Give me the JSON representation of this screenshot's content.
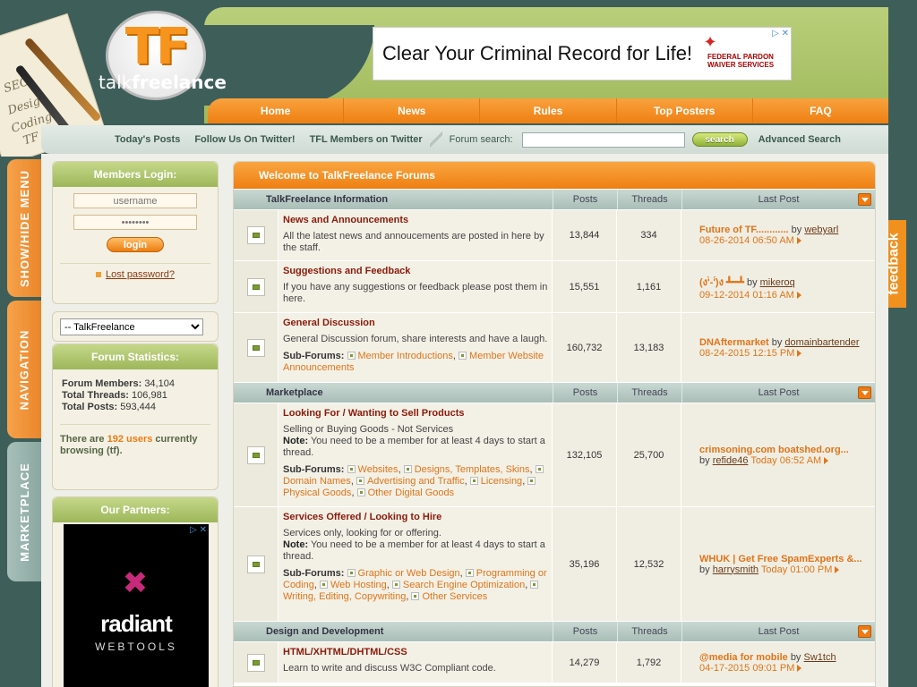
{
  "logo": {
    "letters": "TF",
    "name_part1": "talk",
    "name_part2": "freelance"
  },
  "artwork": {
    "words": [
      "SEO",
      "Design",
      "Coding",
      "TF"
    ]
  },
  "ad_top": {
    "headline": "Clear Your Criminal Record for Life!",
    "brand_line1": "FEDERAL PARDON",
    "brand_line2": "WAIVER SERVICES",
    "controls": "▷ ✕"
  },
  "main_nav": [
    "Home",
    "News",
    "Rules",
    "Top Posters",
    "FAQ"
  ],
  "sub_nav": {
    "links": [
      "Today's Posts",
      "Follow Us On Twitter!",
      "TFL Members on Twitter"
    ],
    "search_label": "Forum search:",
    "search_value": "",
    "search_button": "search",
    "advanced": "Advanced Search"
  },
  "side_tabs": {
    "show_hide": "SHOW/HIDE MENU",
    "navigation": "NAVIGATION",
    "marketplace": "MARKETPLACE"
  },
  "feedback": "feedback",
  "login": {
    "title": "Members Login:",
    "username_placeholder": "username",
    "password_placeholder": "••••••••",
    "button": "login",
    "lost_password": "Lost password?"
  },
  "jump": {
    "selected": "-- TalkFreelance"
  },
  "stats": {
    "title": "Forum Statistics:",
    "members_label": "Forum Members:",
    "members": "34,104",
    "threads_label": "Total Threads:",
    "threads": "106,981",
    "posts_label": "Total Posts:",
    "posts": "593,444",
    "online_pre": "There are",
    "online_count": "192 users",
    "online_post": "currently browsing (tf)."
  },
  "partners": {
    "title": "Our Partners:",
    "ad_brand": "radiant",
    "ad_sub": "WEBTOOLS",
    "controls": "▷ ✕"
  },
  "forum": {
    "welcome": "Welcome to TalkFreelance Forums",
    "col_posts": "Posts",
    "col_threads": "Threads",
    "col_last": "Last Post",
    "subforums_label": "Sub-Forums:",
    "categories": [
      {
        "title": "TalkFreelance Information",
        "forums": [
          {
            "title": "News and Announcements",
            "desc": "All the latest news and annoucements are posted in here by the staff.",
            "posts": "13,844",
            "threads": "334",
            "last_title": "Future of TF............",
            "last_user": "webyarl",
            "last_date": "08-26-2014",
            "last_time": "06:50 AM"
          },
          {
            "title": "Suggestions and Feedback",
            "desc": "If you have any suggestions or feedback please post them in here.",
            "posts": "15,551",
            "threads": "1,161",
            "last_title": "(ง'̀-'́)ง ┻━┻",
            "last_user": "mikeroq",
            "last_date": "09-12-2014",
            "last_time": "01:16 AM"
          },
          {
            "title": "General Discussion",
            "desc": "General Discussion forum, share interests and have a laugh.",
            "subs": [
              "Member Introductions",
              "Member Website Announcements"
            ],
            "posts": "160,732",
            "threads": "13,183",
            "last_title": "DNAftermarket",
            "last_user": "domainbartender",
            "last_date": "08-24-2015",
            "last_time": "12:15 PM"
          }
        ]
      },
      {
        "title": "Marketplace",
        "forums": [
          {
            "title": "Looking For / Wanting to Sell Products",
            "desc_line1": "Selling or Buying Goods - Not Services",
            "note_label": "Note:",
            "note": "You need to be a member for at least 4 days to start a thread.",
            "subs": [
              "Websites",
              "Designs, Templates, Skins",
              "Domain Names",
              "Advertising and Traffic",
              "Licensing",
              "Physical Goods",
              "Other Digital Goods"
            ],
            "posts": "132,105",
            "threads": "25,700",
            "last_title": "crimsoning.com boatshed.org...",
            "last_user": "refide46",
            "last_date": "Today",
            "last_time": "06:52 AM"
          },
          {
            "title": "Services Offered / Looking to Hire",
            "desc_line1": "Services only, looking for or offering.",
            "note_label": "Note:",
            "note": "You need to be a member for at least 4 days to start a thread.",
            "subs": [
              "Graphic or Web Design",
              "Programming or Coding",
              "Web Hosting",
              "Search Engine Optimization",
              "Writing, Editing, Copywriting",
              "Other Services"
            ],
            "posts": "35,196",
            "threads": "12,532",
            "last_title": "WHUK | Get Free SpamExperts &...",
            "last_user": "harrysmith",
            "last_date": "Today",
            "last_time": "01:00 PM"
          }
        ]
      },
      {
        "title": "Design and Development",
        "forums": [
          {
            "title": "HTML/XHTML/DHTML/CSS",
            "desc": "Learn to write and discuss W3C Compliant code.",
            "posts": "14,279",
            "threads": "1,792",
            "last_title": "@media for mobile",
            "last_user": "Sw1tch",
            "last_date": "04-17-2015",
            "last_time": "09:01 PM"
          }
        ]
      }
    ]
  },
  "by_word": "by"
}
